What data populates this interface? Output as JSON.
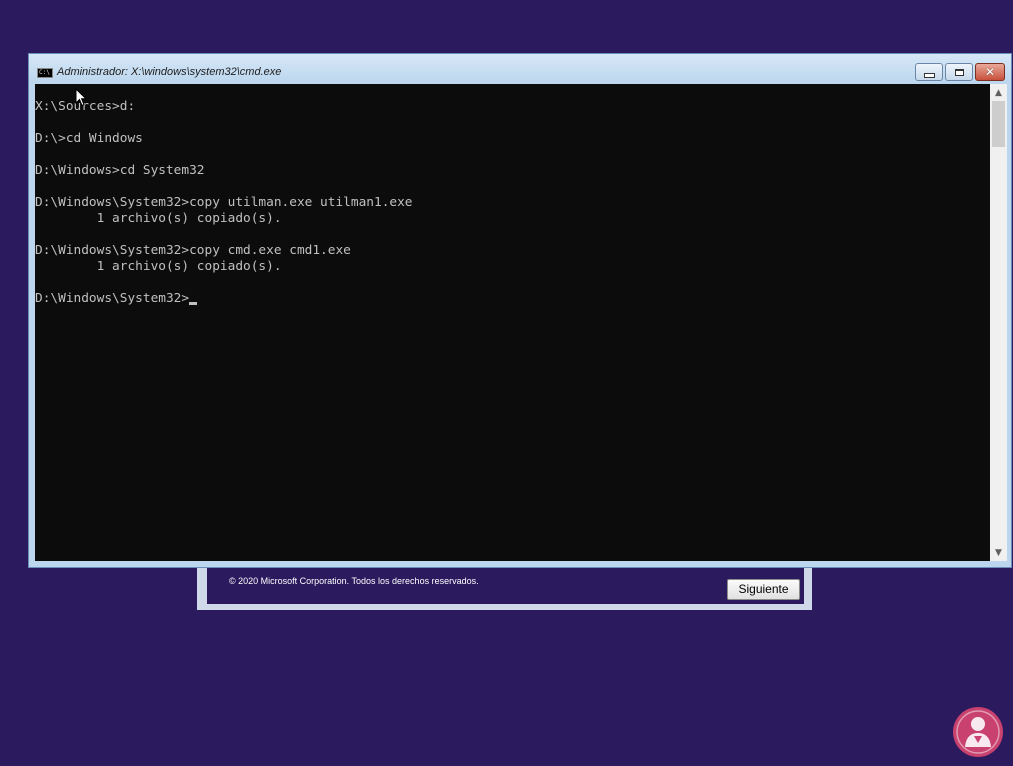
{
  "setup": {
    "copyright": "© 2020 Microsoft Corporation. Todos los derechos reservados.",
    "next_label": "Siguiente"
  },
  "window": {
    "title": "Administrador: X:\\windows\\system32\\cmd.exe",
    "icon_text": "C:\\"
  },
  "console": {
    "lines": [
      "X:\\Sources>d:",
      "",
      "D:\\>cd Windows",
      "",
      "D:\\Windows>cd System32",
      "",
      "D:\\Windows\\System32>copy utilman.exe utilman1.exe",
      "        1 archivo(s) copiado(s).",
      "",
      "D:\\Windows\\System32>copy cmd.exe cmd1.exe",
      "        1 archivo(s) copiado(s).",
      "",
      "D:\\Windows\\System32>"
    ]
  },
  "colors": {
    "desktop": "#2b1a5e",
    "console_bg": "#0c0c0c",
    "console_text": "#c0c0c0",
    "logo": "#c8416f"
  }
}
